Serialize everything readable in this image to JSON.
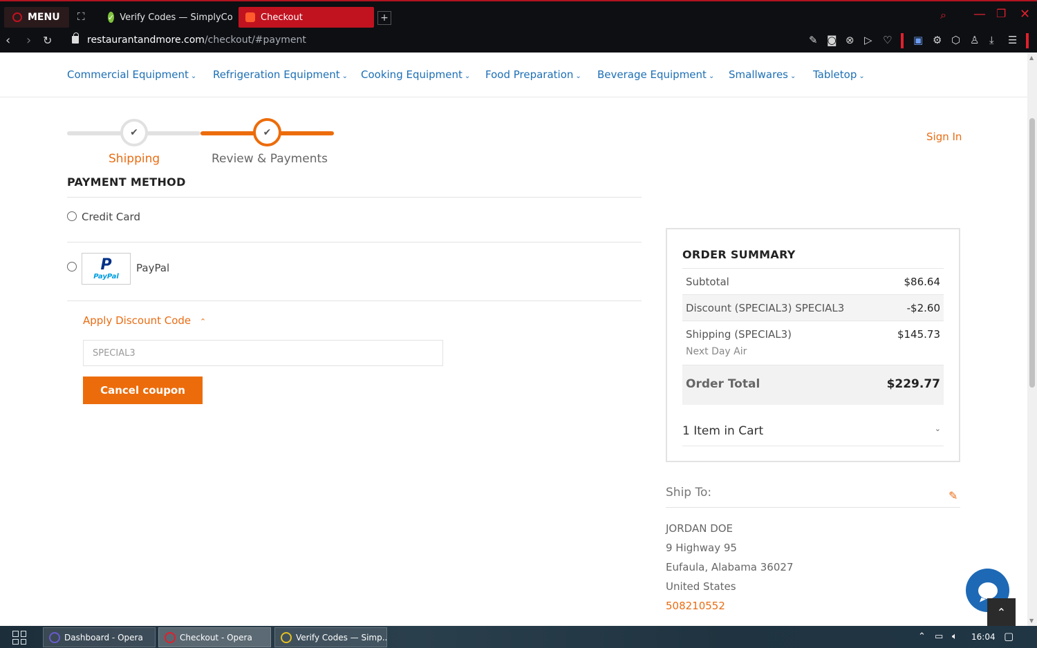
{
  "browser": {
    "menu_label": "MENU",
    "tabs": [
      {
        "title": "Verify Codes — SimplyCo",
        "active": false
      },
      {
        "title": "Checkout",
        "active": true
      }
    ],
    "url_host": "restaurantandmore.com",
    "url_path": "/checkout/#payment"
  },
  "nav": {
    "items": [
      "Commercial Equipment",
      "Refrigeration Equipment",
      "Cooking Equipment",
      "Food Preparation",
      "Beverage Equipment",
      "Smallwares",
      "Tabletop"
    ]
  },
  "checkout": {
    "steps": [
      "Shipping",
      "Review & Payments"
    ],
    "sign_in": "Sign In",
    "payment_method_title": "PAYMENT METHOD",
    "options": [
      "Credit Card",
      "PayPal"
    ],
    "paypal_logo": "PayPal",
    "discount_toggle": "Apply Discount Code",
    "discount_value": "SPECIAL3",
    "cancel_coupon": "Cancel coupon"
  },
  "summary": {
    "title": "ORDER SUMMARY",
    "subtotal_label": "Subtotal",
    "subtotal_value": "$86.64",
    "discount_label": "Discount (SPECIAL3) SPECIAL3",
    "discount_value": "-$2.60",
    "shipping_label": "Shipping (SPECIAL3)",
    "shipping_method": "Next Day Air",
    "shipping_value": "$145.73",
    "total_label": "Order Total",
    "total_value": "$229.77",
    "cart_label": "1 Item in Cart"
  },
  "ship_to": {
    "title": "Ship To:",
    "name": "JORDAN DOE",
    "street": "9 Highway 95",
    "city": "Eufaula, Alabama 36027",
    "country": "United States",
    "phone": "508210552"
  },
  "taskbar": {
    "items": [
      "Dashboard - Opera",
      "Checkout - Opera",
      "Verify Codes — Simp..."
    ],
    "clock": "16:04"
  },
  "colors": {
    "accent_orange": "#ec6c0b",
    "link_blue": "#1c6fb5",
    "opera_red": "#c0131f"
  }
}
